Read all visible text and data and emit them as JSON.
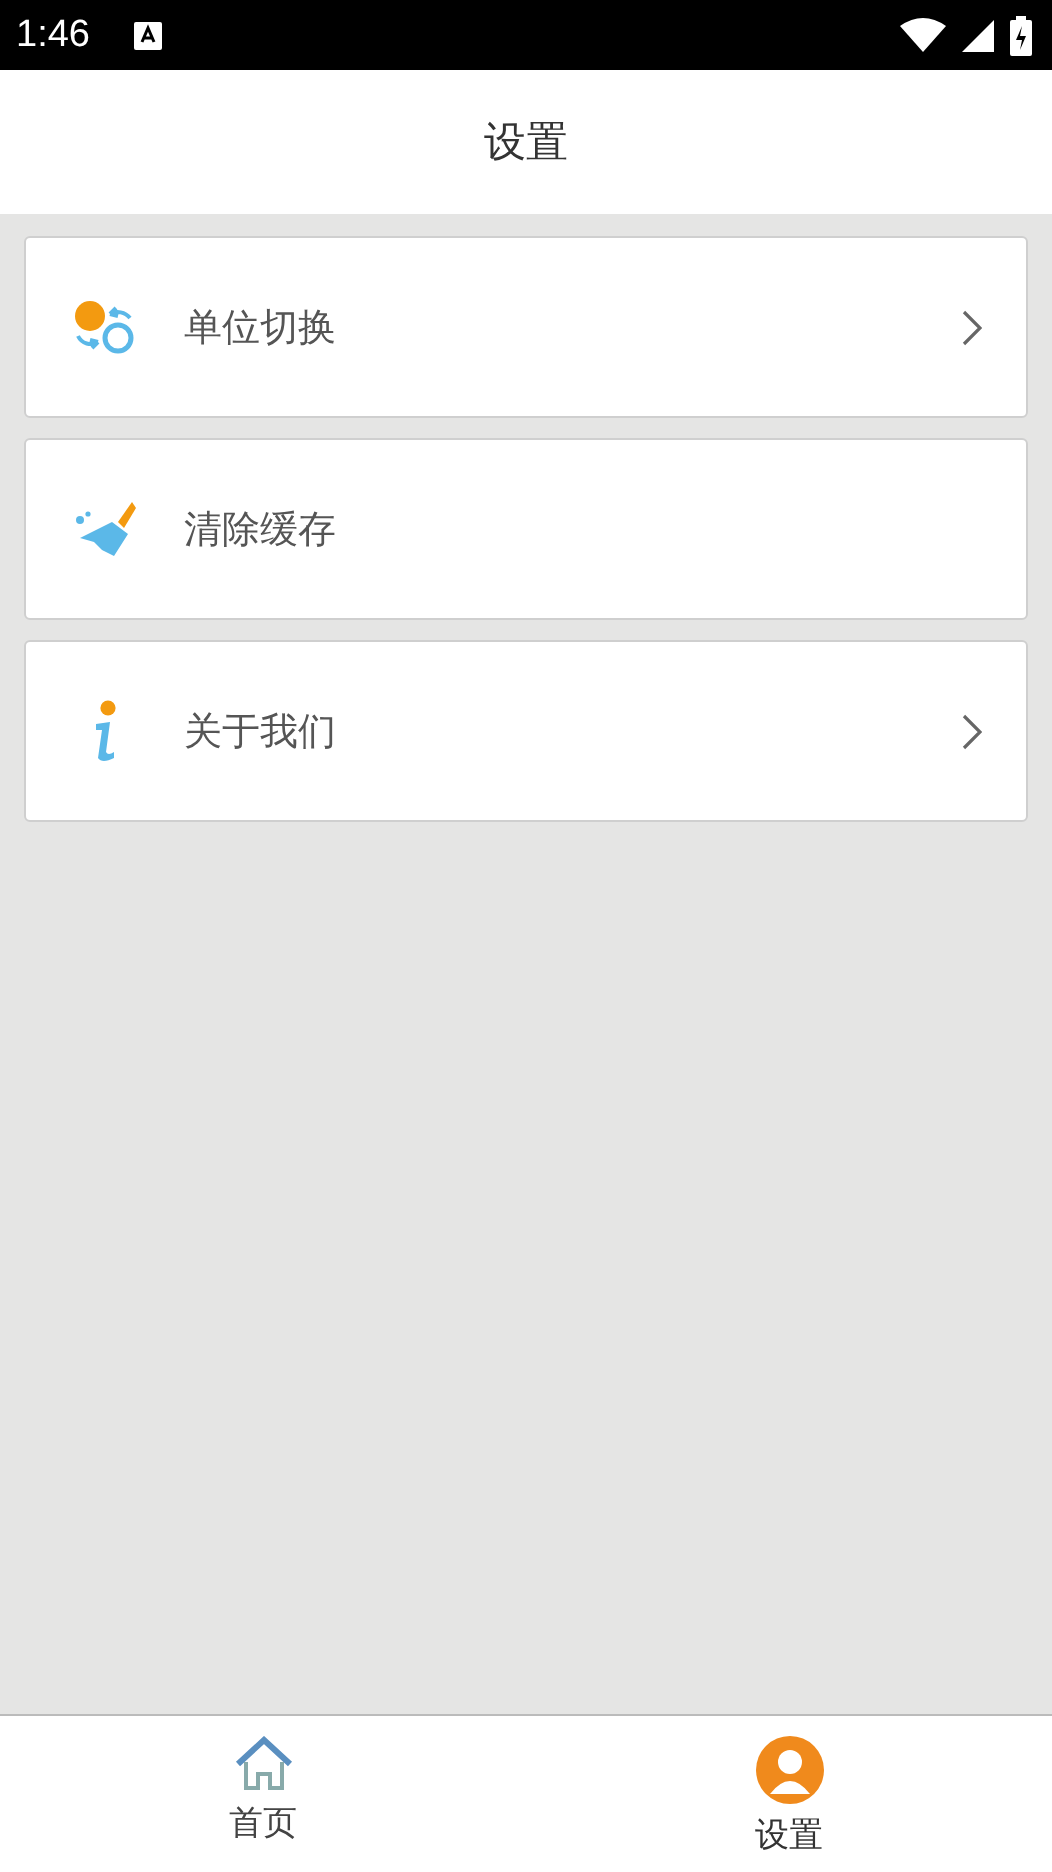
{
  "status_bar": {
    "time": "1:46"
  },
  "header": {
    "title": "设置"
  },
  "settings": [
    {
      "label": "单位切换",
      "has_arrow": true
    },
    {
      "label": "清除缓存",
      "has_arrow": false
    },
    {
      "label": "关于我们",
      "has_arrow": true
    }
  ],
  "tabs": [
    {
      "label": "首页",
      "selected": false
    },
    {
      "label": "设置",
      "selected": true
    }
  ]
}
